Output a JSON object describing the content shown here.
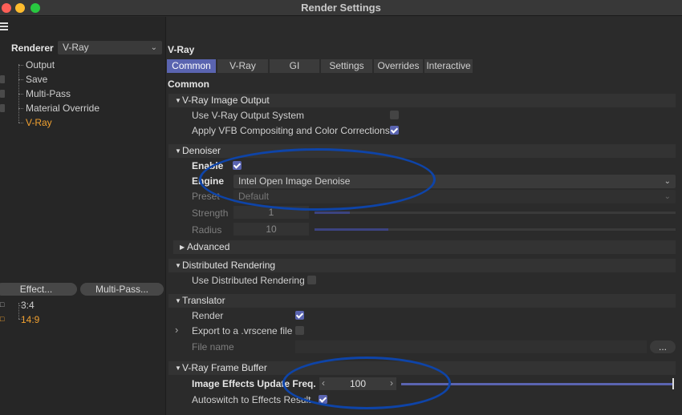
{
  "window": {
    "title": "Render Settings"
  },
  "left": {
    "renderer_label": "Renderer",
    "renderer_value": "V-Ray",
    "tree": [
      "Output",
      "Save",
      "Multi-Pass",
      "Material Override",
      "V-Ray"
    ],
    "effect_button": "Effect...",
    "multipass_button": "Multi-Pass...",
    "presets": [
      "3:4",
      "14:9"
    ]
  },
  "panel": {
    "title": "V-Ray",
    "tabs": [
      "Common",
      "V-Ray",
      "GI",
      "Settings",
      "Overrides",
      "Interactive"
    ],
    "subtitle": "Common"
  },
  "sections": {
    "image_output": {
      "title": "V-Ray Image Output",
      "use_output_system": "Use V-Ray Output System",
      "apply_vfb": "Apply VFB Compositing and Color Corrections"
    },
    "denoiser": {
      "title": "Denoiser",
      "enable": "Enable",
      "engine_label": "Engine",
      "engine_value": "Intel Open Image Denoise",
      "preset_label": "Preset",
      "preset_value": "Default",
      "strength_label": "Strength",
      "strength_value": "1",
      "radius_label": "Radius",
      "radius_value": "10",
      "advanced": "Advanced"
    },
    "distributed": {
      "title": "Distributed Rendering",
      "use": "Use Distributed Rendering"
    },
    "translator": {
      "title": "Translator",
      "render": "Render",
      "export": "Export to a .vrscene file",
      "file_name": "File name",
      "browse": "..."
    },
    "vfb": {
      "title": "V-Ray Frame Buffer",
      "update_freq_label": "Image Effects Update Freq.",
      "update_freq_value": "100",
      "autoswitch": "Autoswitch to Effects Result"
    }
  },
  "colors": {
    "accent": "#5a64b0",
    "highlight": "#f0a030",
    "annotation": "#0e44a8"
  }
}
